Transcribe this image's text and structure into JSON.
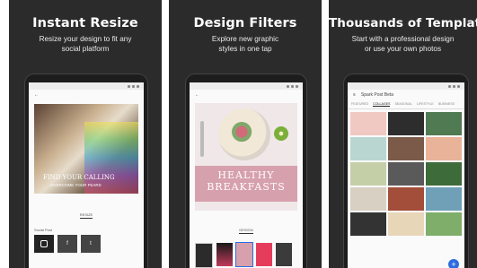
{
  "panels": [
    {
      "title": "Instant Resize",
      "subtitle_line1": "Resize your design to fit any",
      "subtitle_line2": "social platform"
    },
    {
      "title": "Design Filters",
      "subtitle_line1": "Explore new graphic",
      "subtitle_line2": "styles in one tap"
    },
    {
      "title": "Thousands of Templates",
      "subtitle_line1": "Start with a professional design",
      "subtitle_line2": "or use your own photos"
    }
  ],
  "phone1": {
    "overlay_line1": "FIND YOUR CALLING",
    "overlay_line2": "OVERCOME YOUR FEARS",
    "tab_label": "RESIZE",
    "section_label": "Social Post"
  },
  "phone2": {
    "title_line1": "HEALTHY",
    "title_line2": "BREAKFASTS",
    "tab_label": "DESIGN"
  },
  "phone3": {
    "app_title": "Spark Post Beta",
    "tabs": [
      "FEATURED",
      "COLLAGES",
      "SEASONAL",
      "LIFESTYLE",
      "BUSINESS"
    ],
    "active_tab": "COLLAGES"
  },
  "colors": {
    "panel_bg": "#2b2b2b",
    "pink": "#d7a0ad",
    "accent": "#2d6cdf"
  }
}
